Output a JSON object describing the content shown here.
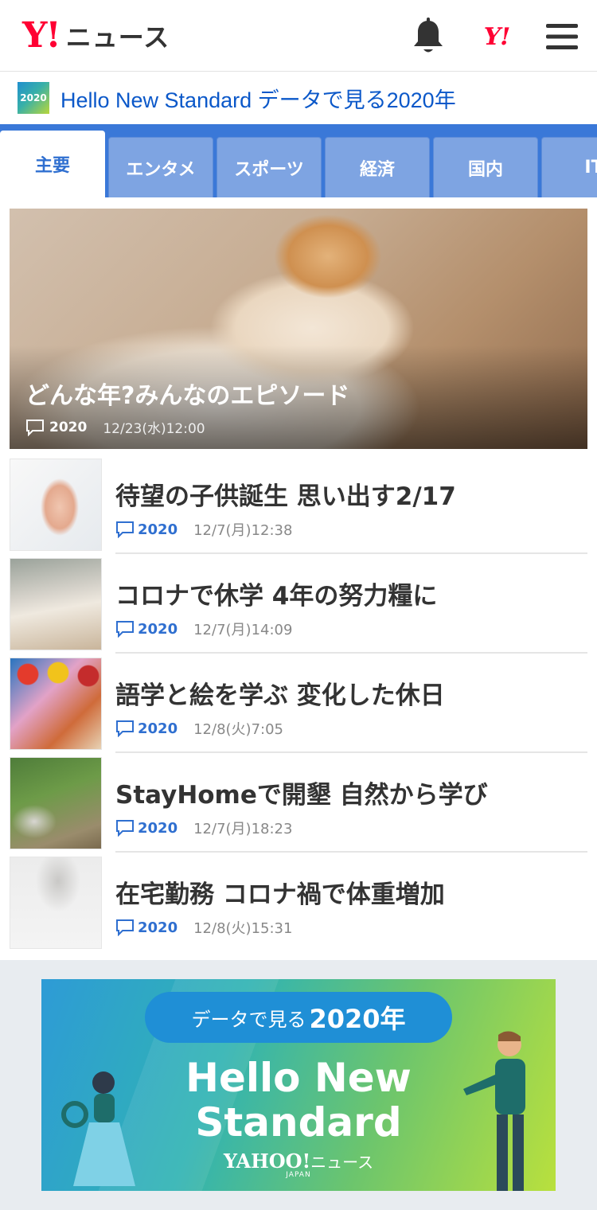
{
  "header": {
    "logo_mark": "Y!",
    "logo_text": "ニュース",
    "yj_label": "Y!"
  },
  "banner": {
    "badge": "2020",
    "title": "Hello New Standard データで見る2020年"
  },
  "tabs": [
    {
      "label": "主要",
      "active": true
    },
    {
      "label": "エンタメ"
    },
    {
      "label": "スポーツ"
    },
    {
      "label": "経済"
    },
    {
      "label": "国内"
    },
    {
      "label": "IT"
    }
  ],
  "hero": {
    "title": "どんな年?みんなのエピソード",
    "comment_label": "2020",
    "date": "12/23(水)12:00"
  },
  "articles": [
    {
      "title": "待望の子供誕生 思い出す2/17",
      "comment_label": "2020",
      "date": "12/7(月)12:38"
    },
    {
      "title": "コロナで休学 4年の努力糧に",
      "comment_label": "2020",
      "date": "12/7(月)14:09"
    },
    {
      "title": "語学と絵を学ぶ 変化した休日",
      "comment_label": "2020",
      "date": "12/8(火)7:05"
    },
    {
      "title": "StayHomeで開墾 自然から学び",
      "comment_label": "2020",
      "date": "12/7(月)18:23"
    },
    {
      "title": "在宅勤務 コロナ禍で体重増加",
      "comment_label": "2020",
      "date": "12/8(火)15:31"
    }
  ],
  "ad": {
    "pill_prefix": "データで見る",
    "pill_year": "2020年",
    "headline_1": "Hello New",
    "headline_2": "Standard",
    "brand": "YAHOO!",
    "brand_sub": "JAPAN",
    "brand_suffix": "ニュース"
  },
  "colors": {
    "brand_red": "#ff0033",
    "tab_bar": "#3a78d8",
    "link_blue": "#0b58c9",
    "comment_blue": "#2f6fd0"
  }
}
